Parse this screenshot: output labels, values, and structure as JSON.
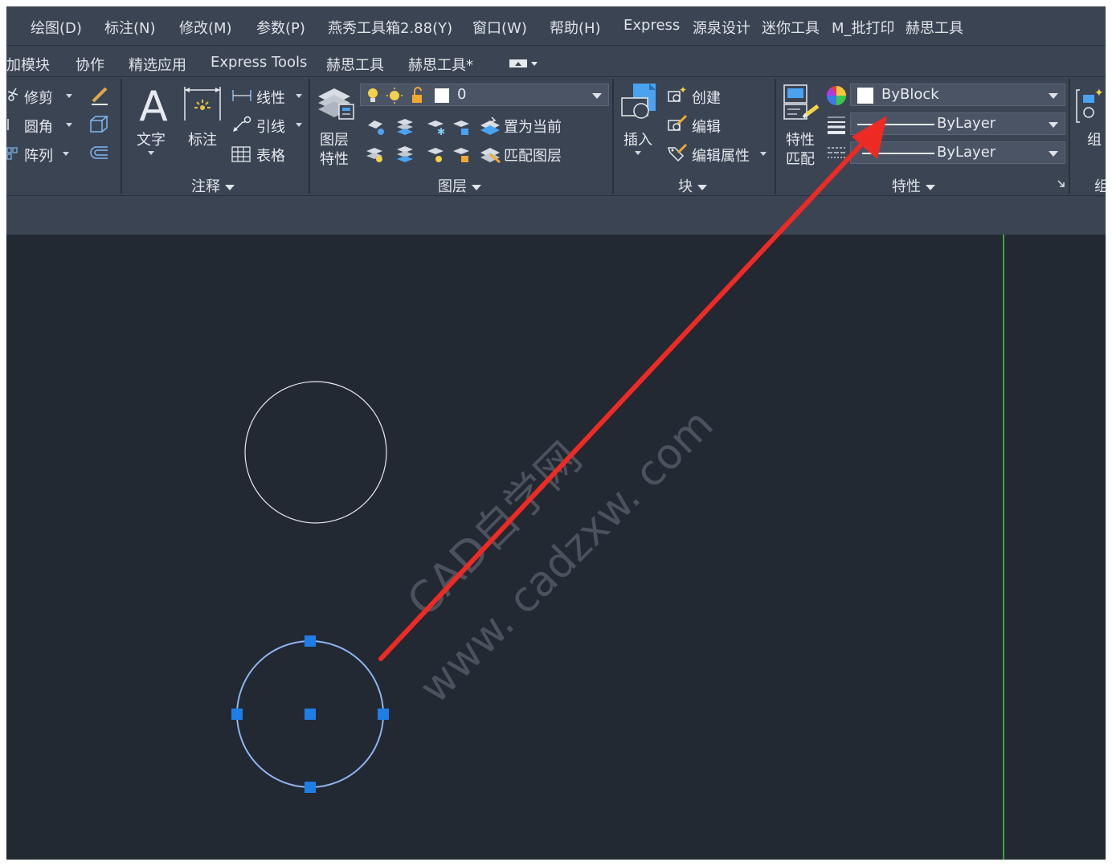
{
  "menubar": {
    "items": [
      "绘图(D)",
      "标注(N)",
      "修改(M)",
      "参数(P)",
      "燕秀工具箱2.88(Y)",
      "窗口(W)",
      "帮助(H)",
      "Express",
      "源泉设计",
      "迷你工具",
      "M_批打印",
      "赫思工具"
    ]
  },
  "tabs": {
    "items": [
      "加模块",
      "协作",
      "精选应用",
      "Express Tools",
      "赫思工具",
      "赫思工具*"
    ]
  },
  "modify_panel": {
    "trim": "修剪",
    "fillet": "圆角",
    "array": "阵列"
  },
  "annotation_panel": {
    "text": "文字",
    "dimension": "标注",
    "linear": "线性",
    "leader": "引线",
    "table": "表格",
    "title": "注释"
  },
  "layer_panel": {
    "layer_props_1": "图层",
    "layer_props_2": "特性",
    "current_layer": "0",
    "set_current": "置为当前",
    "match_layer": "匹配图层",
    "title": "图层"
  },
  "block_panel": {
    "insert": "插入",
    "create": "创建",
    "edit": "编辑",
    "edit_attr": "编辑属性",
    "title": "块"
  },
  "properties_panel": {
    "match_1": "特性",
    "match_2": "匹配",
    "color": "ByBlock",
    "linetype": "ByLayer",
    "lineweight": "ByLayer",
    "title": "特性"
  },
  "group_panel": {
    "group": "组",
    "title_partial": "组"
  },
  "watermark": {
    "line1": "CAD自学网",
    "line2": "www. cadzxw. com"
  },
  "colors": {
    "background": "#222933",
    "ribbon": "#3b4453",
    "grip": "#1e7ee8",
    "selected": "#8fb4f0",
    "arrow": "#ee2a24",
    "axis": "#4cc94c"
  }
}
